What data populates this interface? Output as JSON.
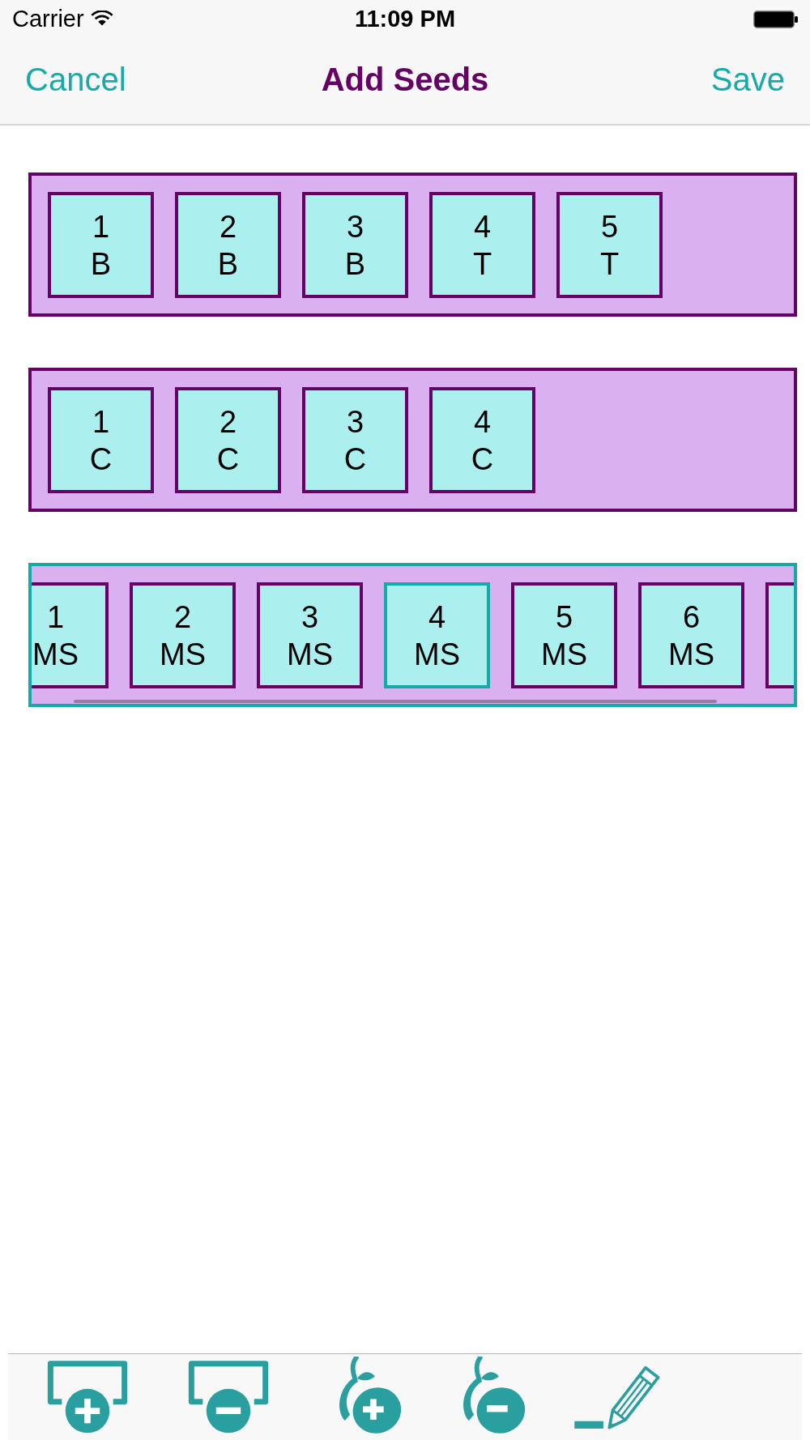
{
  "status_bar": {
    "carrier": "Carrier",
    "time": "11:09 PM"
  },
  "nav_bar": {
    "cancel": "Cancel",
    "title": "Add Seeds",
    "save": "Save"
  },
  "rows": [
    {
      "selected": false,
      "tiles": [
        {
          "number": "1",
          "label": "B",
          "selected": false
        },
        {
          "number": "2",
          "label": "B",
          "selected": false
        },
        {
          "number": "3",
          "label": "B",
          "selected": false
        },
        {
          "number": "4",
          "label": "T",
          "selected": false
        },
        {
          "number": "5",
          "label": "T",
          "selected": false
        }
      ]
    },
    {
      "selected": false,
      "tiles": [
        {
          "number": "1",
          "label": "C",
          "selected": false
        },
        {
          "number": "2",
          "label": "C",
          "selected": false
        },
        {
          "number": "3",
          "label": "C",
          "selected": false
        },
        {
          "number": "4",
          "label": "C",
          "selected": false
        }
      ]
    },
    {
      "selected": true,
      "tiles": [
        {
          "number": "1",
          "label": "MS",
          "selected": false
        },
        {
          "number": "2",
          "label": "MS",
          "selected": false
        },
        {
          "number": "3",
          "label": "MS",
          "selected": false
        },
        {
          "number": "4",
          "label": "MS",
          "selected": true
        },
        {
          "number": "5",
          "label": "MS",
          "selected": false
        },
        {
          "number": "6",
          "label": "MS",
          "selected": false
        },
        {
          "selected": false
        }
      ]
    }
  ]
}
